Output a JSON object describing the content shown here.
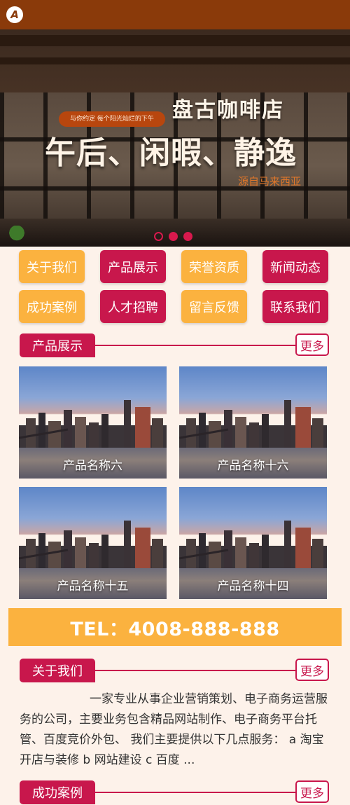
{
  "header": {
    "logo_letter": "A"
  },
  "banner": {
    "tagline": "与你约定 每个阳光灿烂的下午",
    "shop_name": "盘古咖啡店",
    "headline": "午后、闲暇、静逸",
    "source": "源自马来西亚",
    "dots": [
      {
        "active": true
      },
      {
        "active": false
      },
      {
        "active": false
      }
    ]
  },
  "nav": {
    "items": [
      {
        "label": "关于我们",
        "color": "#fbb23f"
      },
      {
        "label": "产品展示",
        "color": "#c8174c"
      },
      {
        "label": "荣誉资质",
        "color": "#fbb23f"
      },
      {
        "label": "新闻动态",
        "color": "#c8174c"
      },
      {
        "label": "成功案例",
        "color": "#fbb23f"
      },
      {
        "label": "人才招聘",
        "color": "#c8174c"
      },
      {
        "label": "留言反馈",
        "color": "#fbb23f"
      },
      {
        "label": "联系我们",
        "color": "#c8174c"
      }
    ]
  },
  "products_section": {
    "title": "产品展示",
    "more": "更多",
    "items": [
      {
        "name": "产品名称六"
      },
      {
        "name": "产品名称十六"
      },
      {
        "name": "产品名称十五"
      },
      {
        "name": "产品名称十四"
      }
    ]
  },
  "tel": {
    "text": "TEL：4008-888-888"
  },
  "about_section": {
    "title": "关于我们",
    "more": "更多",
    "text": "一家专业从事企业营销策划、电子商务运营服务的公司，主要业务包含精品网站制作、电子商务平台托管、百度竞价外包、 我们主要提供以下几点服务： a 淘宝开店与装修 b 网站建设 c 百度 ..."
  },
  "cases_section": {
    "title": "成功案例",
    "more": "更多"
  },
  "colors": {
    "brand_brown": "#8a3a0a",
    "accent_red": "#c8174c",
    "accent_yellow": "#fbb23f",
    "page_bg": "#fdf2ea"
  }
}
